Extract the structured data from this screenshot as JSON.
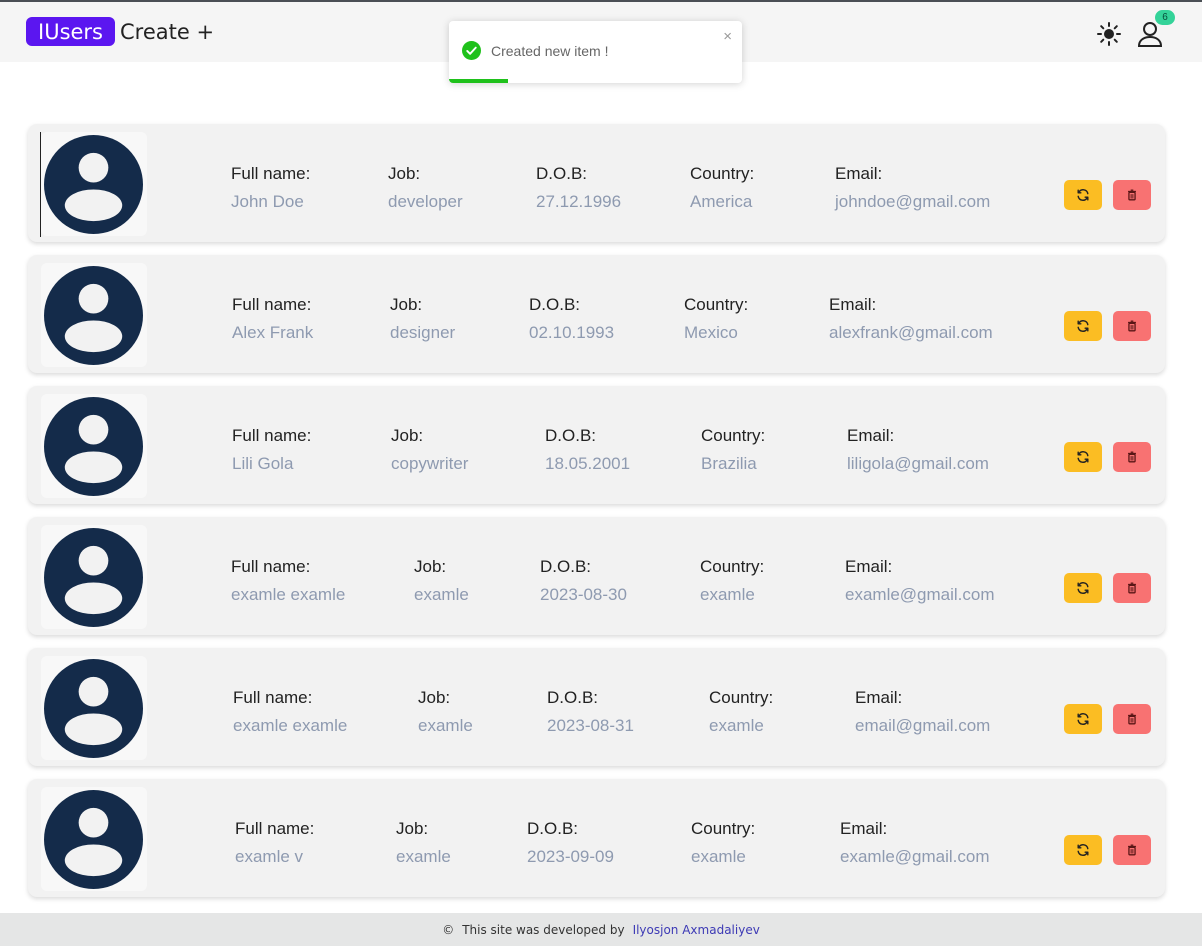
{
  "header": {
    "logo": "IUsers",
    "create_link": "Create +",
    "notification_count": "6",
    "theme_icon": "sun-icon",
    "profile_icon": "user-icon"
  },
  "toast": {
    "message": "Created new item !",
    "close": "×",
    "progress_fraction": 0.2,
    "icon": "check-circle-icon",
    "color": "#1fc11b"
  },
  "labels": {
    "full_name": "Full name:",
    "job": "Job:",
    "dob": "D.O.B:",
    "country": "Country:",
    "email": "Email:"
  },
  "users": [
    {
      "full_name": "John Doe",
      "job": "developer",
      "dob": "27.12.1996",
      "country": "America",
      "email": "johndoe@gmail.com"
    },
    {
      "full_name": "Alex Frank",
      "job": "designer",
      "dob": "02.10.1993",
      "country": "Mexico",
      "email": "alexfrank@gmail.com"
    },
    {
      "full_name": "Lili Gola",
      "job": "copywriter",
      "dob": "18.05.2001",
      "country": "Brazilia",
      "email": "liligola@gmail.com"
    },
    {
      "full_name": "examle examle",
      "job": "examle",
      "dob": "2023-08-30",
      "country": "examle",
      "email": "examle@gmail.com"
    },
    {
      "full_name": "examle examle",
      "job": "examle",
      "dob": "2023-08-31",
      "country": "examle",
      "email": "email@gmail.com"
    },
    {
      "full_name": "examle v",
      "job": "examle",
      "dob": "2023-09-09",
      "country": "examle",
      "email": "examle@gmail.com"
    }
  ],
  "actions": {
    "update_icon": "refresh-icon",
    "delete_icon": "trash-icon",
    "update_color": "#fbbd23",
    "delete_color": "#f87272"
  },
  "footer": {
    "copyright_icon": "©",
    "text": "This site was developed by",
    "author": "Ilyosjon Axmadaliyev"
  },
  "colors": {
    "brand": "#5b16f0",
    "avatar": "#142b4a",
    "value_text": "#8e9ab0"
  }
}
